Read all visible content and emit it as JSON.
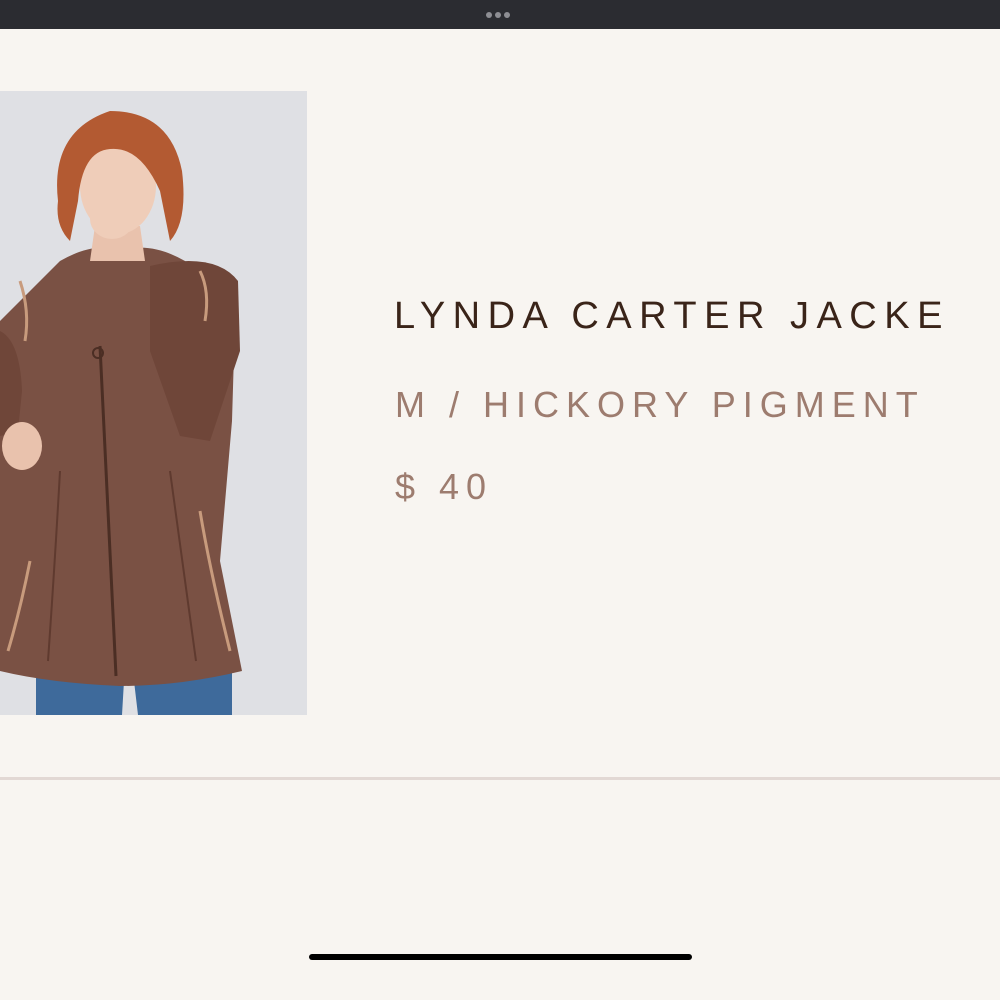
{
  "status_bar": {
    "multitasking_icon": "ellipsis-icon"
  },
  "product": {
    "title": "LYNDA CARTER JACKE",
    "variant": "M / HICKORY PIGMENT",
    "price": "$ 40",
    "image": {
      "icon": "product-photo",
      "description_colors": {
        "jacket": "#7a5144",
        "hair": "#b35a32",
        "jeans": "#3e6a9b",
        "background": "#dfe0e4"
      }
    }
  },
  "theme": {
    "title_color": "#3a2419",
    "subtitle_color": "#9d7c6f",
    "background": "#f8f5f1",
    "divider": "#e2d8d4"
  }
}
